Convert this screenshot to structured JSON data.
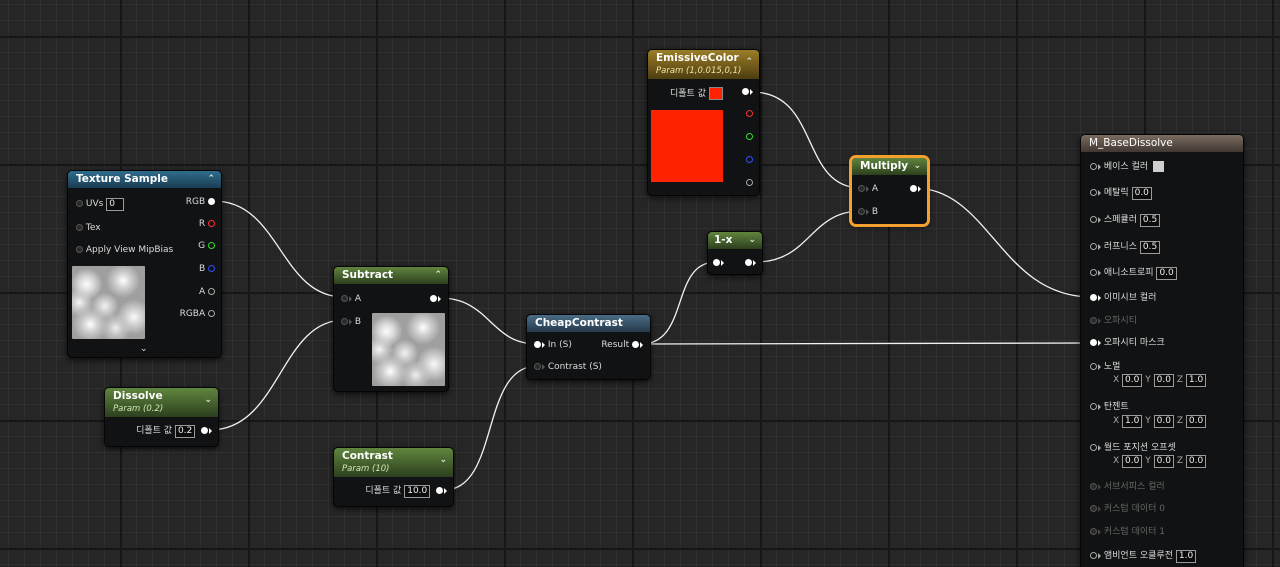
{
  "nodes": {
    "texture_sample": {
      "title": "Texture Sample",
      "uvs_label": "UVs",
      "uvs_value": "0",
      "tex_label": "Tex",
      "mipbias_label": "Apply View MipBias",
      "outputs": [
        "RGB",
        "R",
        "G",
        "B",
        "A",
        "RGBA"
      ],
      "expand_icon": "chevron-down-icon"
    },
    "dissolve": {
      "title": "Dissolve",
      "subtitle": "Param (0.2)",
      "default_label": "디폴트 값",
      "default_value": "0.2"
    },
    "subtract": {
      "title": "Subtract",
      "input_a": "A",
      "input_b": "B"
    },
    "contrast": {
      "title": "Contrast",
      "subtitle": "Param (10)",
      "default_label": "디폴트 값",
      "default_value": "10.0"
    },
    "cheap_contrast": {
      "title": "CheapContrast",
      "input_in": "In (S)",
      "input_contrast": "Contrast (S)",
      "output_result": "Result"
    },
    "emissive_color": {
      "title": "EmissiveColor",
      "subtitle": "Param (1,0.015,0,1)",
      "default_label": "디폴트 값",
      "color": "#ff2200"
    },
    "one_minus": {
      "title": "1-x"
    },
    "multiply": {
      "title": "Multiply",
      "input_a": "A",
      "input_b": "B"
    },
    "material": {
      "title": "M_BaseDissolve",
      "base_color": {
        "label": "베이스 컬러",
        "swatch": "#cfcfcf"
      },
      "metallic": {
        "label": "메탈릭",
        "value": "0.0"
      },
      "specular": {
        "label": "스페큘러",
        "value": "0.5"
      },
      "roughness": {
        "label": "러프니스",
        "value": "0.5"
      },
      "anisotropy": {
        "label": "애니소트로피",
        "value": "0.0"
      },
      "emissive": {
        "label": "이미시브 컬러"
      },
      "opacity": {
        "label": "오파시티"
      },
      "opacity_mask": {
        "label": "오파시티 마스크"
      },
      "normal": {
        "label": "노멀",
        "x": "0.0",
        "y": "0.0",
        "z": "1.0"
      },
      "tangent": {
        "label": "탄젠트",
        "x": "1.0",
        "y": "0.0",
        "z": "0.0"
      },
      "world_offset": {
        "label": "월드 포지션 오프셋",
        "x": "0.0",
        "y": "0.0",
        "z": "0.0"
      },
      "subsurface": {
        "label": "서브서피스 컬러"
      },
      "custom0": {
        "label": "커스텀 데이터 0"
      },
      "custom1": {
        "label": "커스텀 데이터 1"
      },
      "ao": {
        "label": "앰비언트 오클루전",
        "value": "1.0"
      },
      "axis_x": "X",
      "axis_y": "Y",
      "axis_z": "Z"
    }
  },
  "colors": {
    "selection": "#f3a02e",
    "wire": "#ffffff",
    "pin_r": "#ff3030",
    "pin_g": "#30e030",
    "pin_b": "#3050ff"
  }
}
